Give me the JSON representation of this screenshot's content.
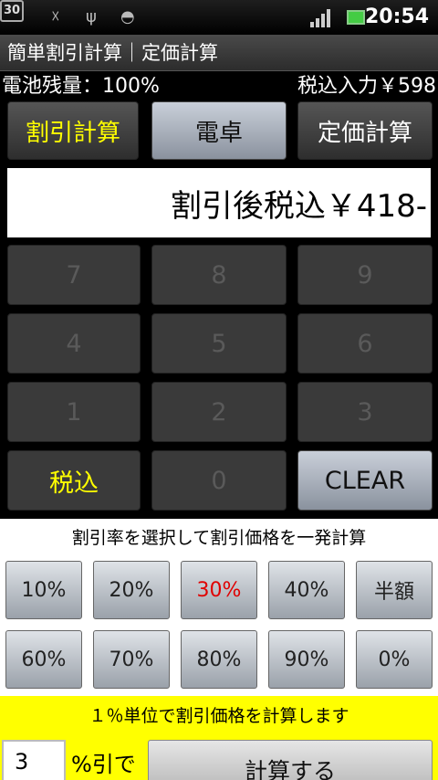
{
  "status_bar": {
    "calendar_day": "30",
    "time": "20:54",
    "icons": [
      "calendar-icon",
      "missed-call-icon",
      "usb-icon",
      "android-debug-icon",
      "signal-icon",
      "battery-icon"
    ]
  },
  "title_bar": {
    "title": "簡単割引計算｜定価計算"
  },
  "info": {
    "battery_level": "電池残量：100%",
    "tax_input": "税込入力￥598"
  },
  "mode_buttons": {
    "discount": "割引計算",
    "calculator": "電卓",
    "list_price": "定価計算"
  },
  "display": {
    "result": "割引後税込￥418-"
  },
  "keypad": {
    "k7": "7",
    "k8": "8",
    "k9": "9",
    "k4": "4",
    "k5": "5",
    "k6": "6",
    "k1": "1",
    "k2": "2",
    "k3": "3",
    "tax": "税込",
    "k0": "0",
    "clear": "CLEAR"
  },
  "rate_section": {
    "hint": "割引率を選択して割引価格を一発計算",
    "rates": [
      "10%",
      "20%",
      "30%",
      "40%",
      "半額",
      "60%",
      "70%",
      "80%",
      "90%",
      "0%"
    ],
    "selected": "30%",
    "selected_color": "#e00000"
  },
  "custom_section": {
    "hint": "１％単位で割引価格を計算します",
    "percent_value": "3",
    "percent_off_label": "%引で",
    "compute_label": "計算する"
  },
  "colors": {
    "accent_yellow": "#ffff00",
    "background": "#000000"
  }
}
